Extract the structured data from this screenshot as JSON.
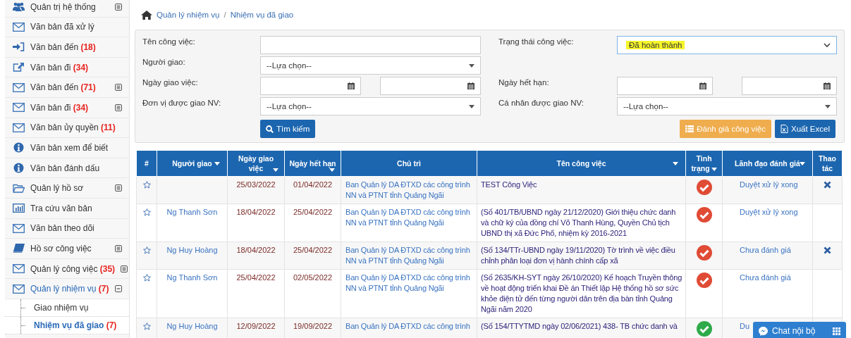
{
  "sidebar": {
    "items": [
      {
        "label": "Quản trị hệ thống",
        "expanded": false,
        "selected": false
      },
      {
        "label": "Văn bản đã xử lý",
        "selected": false
      },
      {
        "label": "Văn bản đến",
        "count": "(18)",
        "selected": false
      },
      {
        "label": "Văn bản đi",
        "count": "(34)",
        "selected": false
      },
      {
        "label": "Văn bản đến",
        "count": "(71)",
        "expanded": false,
        "selected": false
      },
      {
        "label": "Văn bản đi",
        "count": "(34)",
        "expanded": false,
        "selected": false
      },
      {
        "label": "Văn bản ủy quyền",
        "count": "(11)",
        "selected": false
      },
      {
        "label": "Văn bản xem để biết",
        "selected": false
      },
      {
        "label": "Văn bản đánh dấu",
        "selected": false
      },
      {
        "label": "Quản lý hồ sơ",
        "expanded": false,
        "selected": false
      },
      {
        "label": "Tra cứu văn bản",
        "selected": false
      },
      {
        "label": "Văn bản theo dõi",
        "selected": false
      },
      {
        "label": "Hồ sơ công việc",
        "expanded": false,
        "selected": false
      },
      {
        "label": "Quản lý công việc",
        "count": "(35)",
        "expanded": false,
        "selected": false
      },
      {
        "label": "Quản lý nhiệm vụ",
        "count": "(7)",
        "expanded": true,
        "selected": true,
        "children": [
          {
            "label": "Giao nhiệm vụ",
            "selected": false
          },
          {
            "label": "Nhiệm vụ đã giao",
            "count": "(7)",
            "selected": true
          }
        ]
      }
    ]
  },
  "breadcrumb": [
    "Quản lý nhiệm vụ",
    "/",
    "Nhiệm vụ đã giao"
  ],
  "filter": {
    "rows": [
      {
        "left": {
          "label": "Tên công việc:",
          "kind": "text"
        },
        "right": {
          "label": "Trạng thái công việc:",
          "kind": "native-select",
          "value": "Đã hoàn thành",
          "highlighted": true
        }
      },
      {
        "left": {
          "label": "Người giao:",
          "kind": "select",
          "value": "--Lựa chọn--"
        }
      },
      {
        "left": {
          "label": "Ngày giao việc:",
          "kind": "date-range"
        },
        "right": {
          "label": "Ngày hết hạn:",
          "kind": "date-range"
        }
      },
      {
        "left": {
          "label": "Đơn vị được giao NV:",
          "kind": "select",
          "value": "--Lựa chọn--"
        },
        "right": {
          "label": "Cá nhân được giao NV:",
          "kind": "select",
          "value": "--Lựa chọn--"
        }
      }
    ],
    "search_button": "Tìm kiếm",
    "actions": [
      {
        "label": "Đánh giá công việc",
        "kind": "evaluate"
      },
      {
        "label": "Xuất Excel",
        "kind": "excel"
      }
    ]
  },
  "table": {
    "columns": [
      {
        "label": "#",
        "sortable": false
      },
      {
        "label": "Người giao",
        "sortable": true
      },
      {
        "label": "Ngày giao việc",
        "sortable": true
      },
      {
        "label": "Ngày hết hạn",
        "sortable": true
      },
      {
        "label": "Chủ trì",
        "sortable": false
      },
      {
        "label": "Tên công việc",
        "sortable": true
      },
      {
        "label": "Tình trạng",
        "sortable": true
      },
      {
        "label": "Lãnh đạo đánh giá",
        "sortable": true
      },
      {
        "label": "Thao tác",
        "sortable": false
      }
    ],
    "rows": [
      {
        "assigner": "",
        "assigned": "25/03/2022",
        "due": "01/04/2022",
        "host": "Ban Quản lý DA ĐTXD các công trình NN và PTNT tỉnh Quảng Ngãi",
        "task": "TEST Công Việc",
        "color": "#e04b35",
        "review": "Duyệt xử lý xong",
        "deletable": true
      },
      {
        "assigner": "Ng Thanh Sơn",
        "assigned": "18/04/2022",
        "due": "25/04/2022",
        "host": "Ban Quản lý DA ĐTXD các công trình NN và PTNT tỉnh Quảng Ngãi",
        "task": "(Số 401/TB/UBND ngày 21/12/2020) Giới thiệu chức danh và chữ ký của đồng chí Võ Thanh Hùng, Quyền Chủ tịch UBND thị xã Đức Phổ, nhiệm kỳ 2016-2021",
        "color": "#e04b35",
        "review": "Duyệt xử lý xong",
        "deletable": false
      },
      {
        "assigner": "Ng Huy Hoàng",
        "assigned": "18/04/2022",
        "due": "25/04/2022",
        "host": "Ban Quản lý DA ĐTXD các công trình NN và PTNT tỉnh Quảng Ngãi",
        "task": "(Số 134/TTr-UBND ngày 19/11/2020) Tờ trình về việc điều chỉnh phân loại đơn vị hành chính cấp xã",
        "color": "#e04b35",
        "review": "Chưa đánh giá",
        "deletable": true
      },
      {
        "assigner": "Ng Thanh Sơn",
        "assigned": "25/04/2022",
        "due": "02/05/2022",
        "host": "Ban Quản lý DA ĐTXD các công trình NN và PTNT tỉnh Quảng Ngãi",
        "task": "(Số 2635/KH-SYT ngày 26/10/2020) Kế hoạch Truyền thông về hoạt động triển khai Đề án Thiết lập Hệ thống hồ sơ sức khỏe điện tử đến từng người dân trên địa bàn tỉnh Quảng Ngãi năm 2020",
        "color": "#e04b35",
        "review": "Chưa đánh giá",
        "deletable": false
      },
      {
        "assigner": "Ng Huy Hoàng",
        "assigned": "12/09/2022",
        "due": "19/09/2022",
        "host": "Ban Quản lý DA ĐTXD các công trình",
        "task": "(Số 154/TTYTMD ngày 02/06/2021) 438- TB chức danh và",
        "color": "#2eaa4a",
        "review": "Du",
        "deletable": false
      }
    ]
  },
  "chat": {
    "label": "Chat nội bộ"
  }
}
